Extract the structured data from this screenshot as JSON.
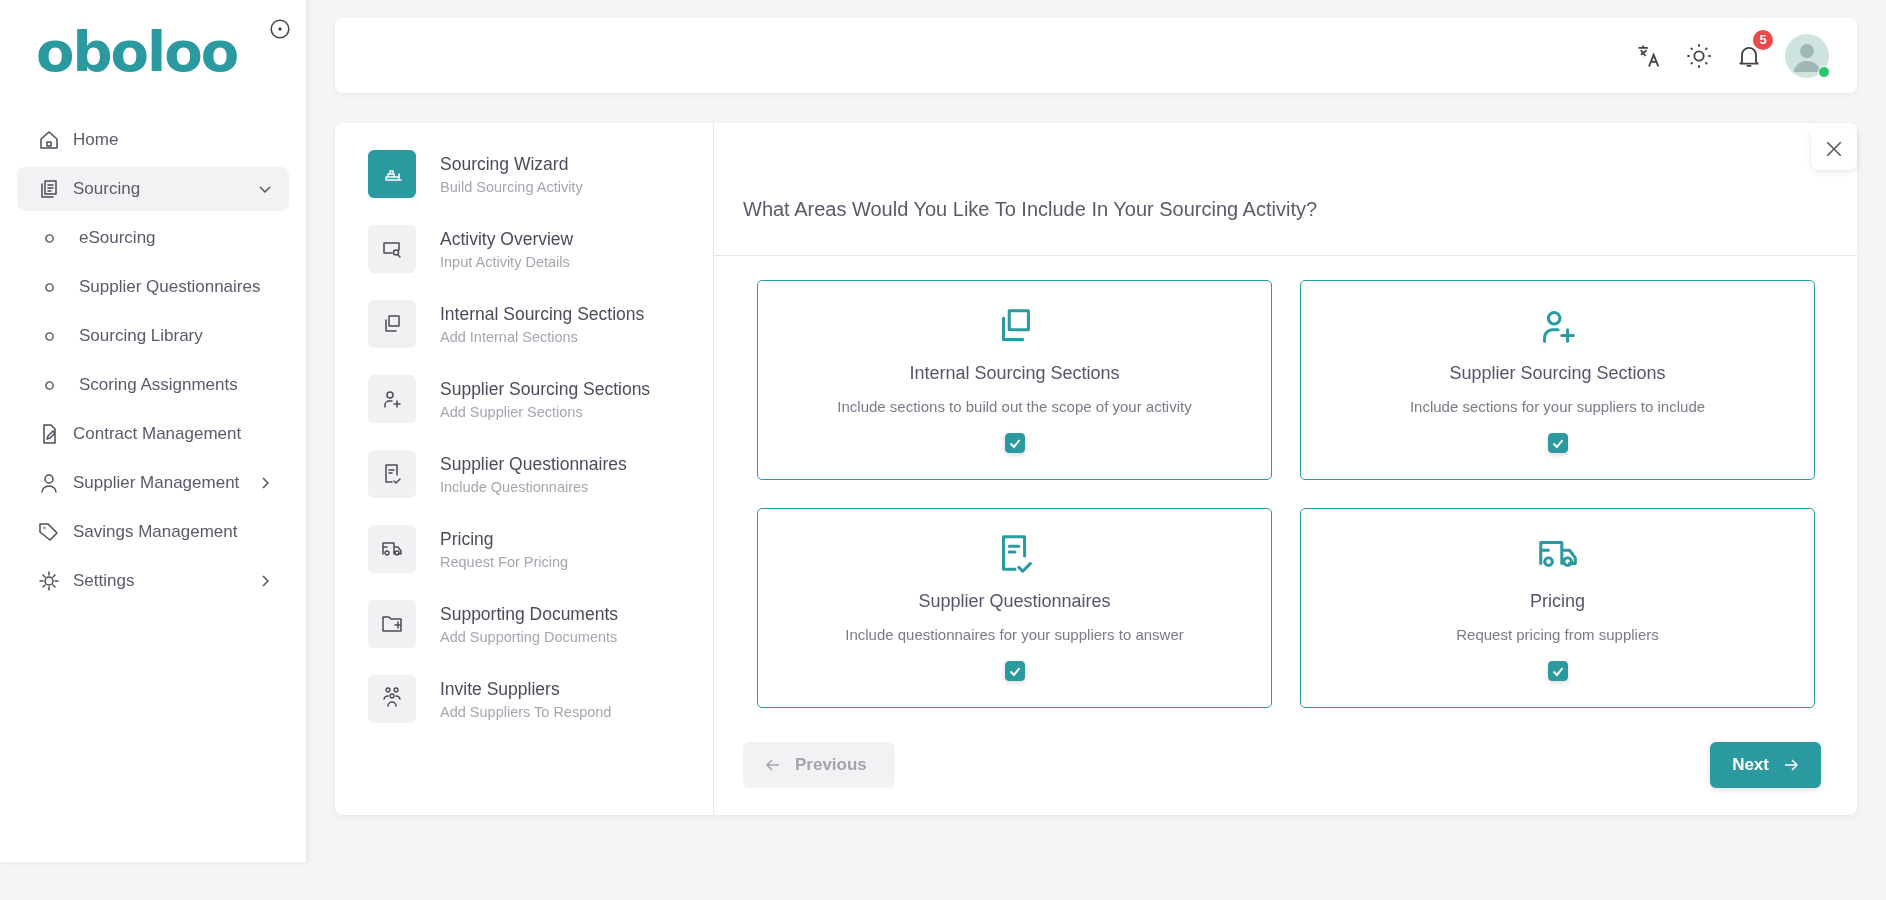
{
  "sidebar": {
    "logo": "oboloo",
    "items": [
      {
        "label": "Home",
        "kind": "item",
        "selected": false
      },
      {
        "label": "Sourcing",
        "kind": "item",
        "selected": true,
        "expanded": true
      },
      {
        "label": "eSourcing",
        "kind": "subitem",
        "selected": false
      },
      {
        "label": "Supplier Questionnaires",
        "kind": "subitem",
        "selected": false
      },
      {
        "label": "Sourcing Library",
        "kind": "subitem",
        "selected": false
      },
      {
        "label": "Scoring Assignments",
        "kind": "subitem",
        "selected": false
      },
      {
        "label": "Contract Management",
        "kind": "item",
        "selected": false
      },
      {
        "label": "Supplier Management",
        "kind": "item",
        "selected": false,
        "expanded": false
      },
      {
        "label": "Savings Management",
        "kind": "item",
        "selected": false
      },
      {
        "label": "Settings",
        "kind": "item",
        "selected": false,
        "expanded": false
      }
    ]
  },
  "topbar": {
    "notification_count": "5",
    "avatar": {
      "online": true
    }
  },
  "steps": [
    {
      "title": "Sourcing Wizard",
      "subtitle": "Build Sourcing Activity",
      "selected": true
    },
    {
      "title": "Activity Overview",
      "subtitle": "Input Activity Details",
      "selected": false
    },
    {
      "title": "Internal Sourcing Sections",
      "subtitle": "Add Internal Sections",
      "selected": false
    },
    {
      "title": "Supplier Sourcing Sections",
      "subtitle": "Add Supplier Sections",
      "selected": false
    },
    {
      "title": "Supplier Questionnaires",
      "subtitle": "Include Questionnaires",
      "selected": false
    },
    {
      "title": "Pricing",
      "subtitle": "Request For Pricing",
      "selected": false
    },
    {
      "title": "Supporting Documents",
      "subtitle": "Add Supporting Documents",
      "selected": false
    },
    {
      "title": "Invite Suppliers",
      "subtitle": "Add Suppliers To Respond",
      "selected": false
    }
  ],
  "question": "What Areas Would You Like To Include In Your Sourcing Activity?",
  "options": [
    {
      "title": "Internal Sourcing Sections",
      "description": "Include sections to build out the scope of your activity",
      "checked": true
    },
    {
      "title": "Supplier Sourcing Sections",
      "description": "Include sections for your suppliers to include",
      "checked": true
    },
    {
      "title": "Supplier Questionnaires",
      "description": "Include questionnaires for your suppliers to answer",
      "checked": true
    },
    {
      "title": "Pricing",
      "description": "Request pricing from suppliers",
      "checked": true
    }
  ],
  "buttons": [
    {
      "label": "Previous",
      "kind": "back",
      "disabled": true
    },
    {
      "label": "Next",
      "kind": "forward",
      "disabled": false
    }
  ]
}
